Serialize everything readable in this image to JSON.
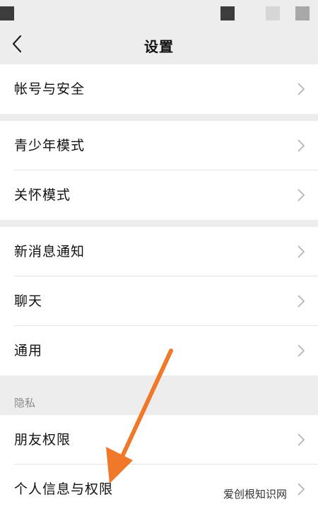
{
  "header": {
    "title": "设置"
  },
  "groups": [
    {
      "items": [
        {
          "label": "帐号与安全"
        }
      ]
    },
    {
      "items": [
        {
          "label": "青少年模式"
        },
        {
          "label": "关怀模式"
        }
      ]
    },
    {
      "items": [
        {
          "label": "新消息通知"
        },
        {
          "label": "聊天"
        },
        {
          "label": "通用"
        }
      ]
    }
  ],
  "privacy": {
    "header": "隐私",
    "items": [
      {
        "label": "朋友权限"
      },
      {
        "label": "个人信息与权限"
      }
    ]
  },
  "annotation": {
    "arrow_color": "#f0782a"
  },
  "watermark": "爱创根知识网",
  "icons": {
    "back": "chevron-left-icon",
    "row": "chevron-right-icon"
  },
  "colors": {
    "background": "#ededed",
    "card": "#ffffff",
    "section_text": "#8a8a8a"
  }
}
